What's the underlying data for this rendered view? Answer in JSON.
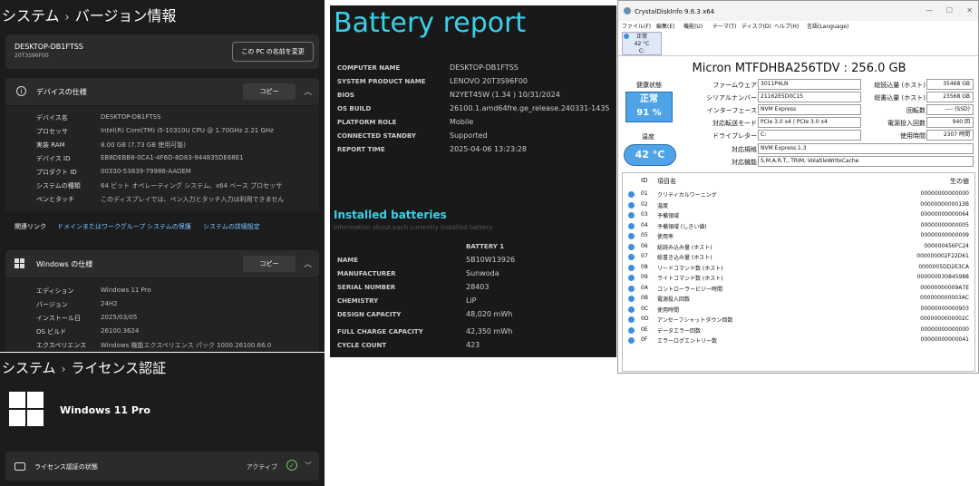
{
  "windows_settings": {
    "breadcrumb_parent": "システム",
    "breadcrumb_sep": "›",
    "page_title": "バージョン情報",
    "pc_name": "DESKTOP-DB1FTSS",
    "pc_model": "20T3S96F00",
    "rename_button": "この PC の名前を変更",
    "device_spec": {
      "title": "デバイスの仕様",
      "copy_button": "コピー",
      "rows": [
        {
          "label": "デバイス名",
          "value": "DESKTOP-DB1FTSS"
        },
        {
          "label": "プロセッサ",
          "value": "Intel(R) Core(TM) i5-10310U CPU @ 1.70GHz   2.21 GHz"
        },
        {
          "label": "実装 RAM",
          "value": "8.00 GB (7.73 GB 使用可能)"
        },
        {
          "label": "デバイス ID",
          "value": "EB8DEBB8-0CA1-4F6D-8D83-944835DE68E1"
        },
        {
          "label": "プロダクト ID",
          "value": "00330-53839-79986-AAOEM"
        },
        {
          "label": "システムの種類",
          "value": "64 ビット オペレーティング システム、x64 ベース プロセッサ"
        },
        {
          "label": "ペンとタッチ",
          "value": "このディスプレイでは、ペン入力とタッチ入力は利用できません"
        }
      ]
    },
    "related_links": {
      "label": "関連リンク",
      "links": [
        "ドメインまたはワークグループ",
        "システムの保護",
        "システムの詳細設定"
      ]
    },
    "windows_spec": {
      "title": "Windows の仕様",
      "copy_button": "コピー",
      "rows": [
        {
          "label": "エディション",
          "value": "Windows 11 Pro"
        },
        {
          "label": "バージョン",
          "value": "24H2"
        },
        {
          "label": "インストール日",
          "value": "2025/03/05"
        },
        {
          "label": "OS ビルド",
          "value": "26100.3624"
        },
        {
          "label": "エクスペリエンス",
          "value": "Windows 機能エクスペリエンス パック 1000.26100.66.0"
        }
      ]
    }
  },
  "license": {
    "breadcrumb_parent": "システム",
    "breadcrumb_sep": "›",
    "page_title": "ライセンス認証",
    "edition": "Windows 11 Pro",
    "status_label": "ライセンス認証の状態",
    "status_value": "アクティブ"
  },
  "battery_report": {
    "title": "Battery report",
    "system_rows": [
      {
        "label": "COMPUTER NAME",
        "value": "DESKTOP-DB1FTSS"
      },
      {
        "label": "SYSTEM PRODUCT NAME",
        "value": "LENOVO 20T3S96F00"
      },
      {
        "label": "BIOS",
        "value": "N2YET45W (1.34 ) 10/31/2024"
      },
      {
        "label": "OS BUILD",
        "value": "26100.1.amd64fre.ge_release.240331-1435"
      },
      {
        "label": "PLATFORM ROLE",
        "value": "Mobile"
      },
      {
        "label": "CONNECTED STANDBY",
        "value": "Supported"
      },
      {
        "label": "REPORT TIME",
        "value": "2025-04-06   13:23:28"
      }
    ],
    "installed_title": "Installed batteries",
    "installed_subtitle": "Information about each currently installed battery",
    "battery_column": "BATTERY 1",
    "battery_rows": [
      {
        "label": "NAME",
        "value": "5B10W13926"
      },
      {
        "label": "MANUFACTURER",
        "value": "Sunwoda"
      },
      {
        "label": "SERIAL NUMBER",
        "value": "28403"
      },
      {
        "label": "CHEMISTRY",
        "value": "LiP"
      },
      {
        "label": "DESIGN CAPACITY",
        "value": "48,020 mWh"
      },
      {
        "label": "FULL CHARGE CAPACITY",
        "value": "42,350 mWh"
      },
      {
        "label": "CYCLE COUNT",
        "value": "423"
      }
    ]
  },
  "crystal_disk_info": {
    "window_title": "CrystalDiskInfo 9.6.3 x64",
    "menu": [
      "ファイル(F)",
      "編集(E)",
      "機能(U)",
      "テーマ(T)",
      "ディスク(D)",
      "ヘルプ(H)",
      "言語(Language)"
    ],
    "drive_tab": {
      "status": "正常",
      "temp": "42 °C",
      "letter": "C:"
    },
    "model": "Micron MTFDHBA256TDV : 256.0 GB",
    "health_label": "健康状態",
    "health_status": "正常",
    "health_percent": "91 %",
    "temp_label": "温度",
    "temp_value": "42 °C",
    "left_fields": [
      {
        "label": "ファームウェア",
        "value": "3011P4LN"
      },
      {
        "label": "シリアルナンバー",
        "value": "21162E5D0C15"
      },
      {
        "label": "インターフェース",
        "value": "NVM Express"
      },
      {
        "label": "対応転送モード",
        "value": "PCIe 3.0 x4 | PCIe 3.0 x4"
      },
      {
        "label": "ドライブレター",
        "value": "C:"
      }
    ],
    "right_fields": [
      {
        "label": "総読込量 (ホスト)",
        "value": "35468 GB"
      },
      {
        "label": "総書込量 (ホスト)",
        "value": "23568 GB"
      },
      {
        "label": "回転数",
        "value": "---- (SSD)"
      },
      {
        "label": "電源投入回数",
        "value": "940 回"
      },
      {
        "label": "使用時間",
        "value": "2307 時間"
      }
    ],
    "standard_label": "対応規格",
    "standard_value": "NVM Express 1.3",
    "features_label": "対応機能",
    "features_value": "S.M.A.R.T., TRIM, VolatileWriteCache",
    "smart_headers": {
      "id": "ID",
      "name": "項目名",
      "raw": "生の値"
    },
    "smart_rows": [
      {
        "id": "01",
        "name": "クリティカルワーニング",
        "raw": "00000000000000"
      },
      {
        "id": "02",
        "name": "温度",
        "raw": "0000000000013B"
      },
      {
        "id": "03",
        "name": "予備領域",
        "raw": "00000000000064"
      },
      {
        "id": "04",
        "name": "予備領域 (しきい値)",
        "raw": "00000000000005"
      },
      {
        "id": "05",
        "name": "使用率",
        "raw": "00000000000009"
      },
      {
        "id": "06",
        "name": "総読み込み量 (ホスト)",
        "raw": "000000456FC24"
      },
      {
        "id": "07",
        "name": "総書き込み量 (ホスト)",
        "raw": "000000002F22D61"
      },
      {
        "id": "08",
        "name": "リードコマンド数 (ホスト)",
        "raw": "0000005DD2E3CA"
      },
      {
        "id": "09",
        "name": "ライトコマンド数 (ホスト)",
        "raw": "000000030845988"
      },
      {
        "id": "0A",
        "name": "コントローラービジー時間",
        "raw": "00000000009A7E"
      },
      {
        "id": "0B",
        "name": "電源投入回数",
        "raw": "000000000003AC"
      },
      {
        "id": "0C",
        "name": "使用時間",
        "raw": "00000000000903"
      },
      {
        "id": "0D",
        "name": "アンセーフシャットダウン回数",
        "raw": "0000000000002C"
      },
      {
        "id": "0E",
        "name": "データエラー回数",
        "raw": "00000000000000"
      },
      {
        "id": "0F",
        "name": "エラーログエントリー数",
        "raw": "00000000000041"
      }
    ]
  },
  "colors": {
    "accent": "#3ad0e8",
    "health": "#4fa4e8",
    "active_check": "#6ccb5f"
  }
}
